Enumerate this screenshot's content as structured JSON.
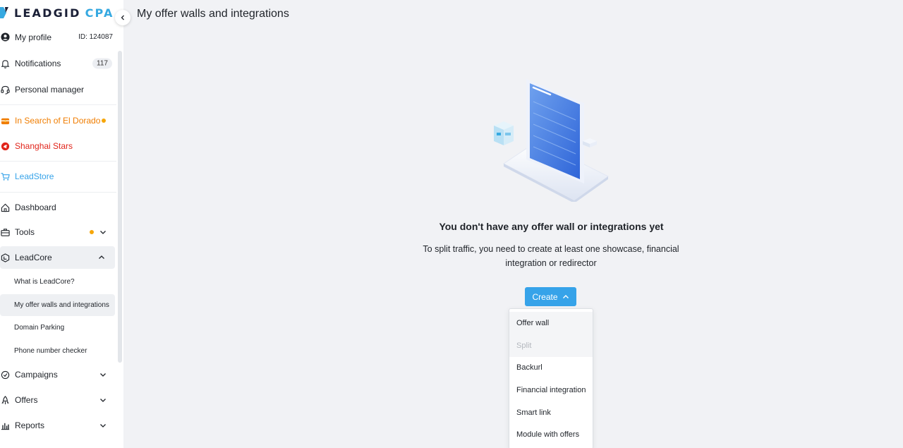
{
  "logo": {
    "brand": "LEADGID",
    "suffix": "CPA"
  },
  "profile": {
    "label": "My profile",
    "id": "ID: 124087"
  },
  "notifications": {
    "label": "Notifications",
    "count": "117"
  },
  "personal_manager": {
    "label": "Personal manager"
  },
  "promos": [
    {
      "label": "In Search of El Dorado",
      "color": "#f07d00"
    },
    {
      "label": "Shanghai Stars",
      "color": "#e1251b"
    }
  ],
  "leadstore": {
    "label": "LeadStore",
    "color": "#36a3e9"
  },
  "nav": {
    "dashboard": "Dashboard",
    "tools": "Tools",
    "leadcore": "LeadCore",
    "leadcore_items": [
      "What is LeadCore?",
      "My offer walls and integrations",
      "Domain Parking",
      "Phone number checker"
    ],
    "campaigns": "Campaigns",
    "offers": "Offers",
    "reports": "Reports"
  },
  "page_title": "My offer walls and integrations",
  "empty_state": {
    "title": "You don't have any offer wall or integrations yet",
    "desc_line1": "To split traffic, you need to create at least one showcase, financial",
    "desc_line2": "integration or redirector"
  },
  "create_button": "Create",
  "create_menu": [
    {
      "label": "Offer wall",
      "state": "hover"
    },
    {
      "label": "Split",
      "state": "disabled"
    },
    {
      "label": "Backurl",
      "state": "normal"
    },
    {
      "label": "Financial integration",
      "state": "normal"
    },
    {
      "label": "Smart link",
      "state": "normal"
    },
    {
      "label": "Module with offers",
      "state": "normal"
    }
  ],
  "colors": {
    "accent": "#36a3e9",
    "badge_dot": "#f6a609",
    "background": "#f1f2f5"
  }
}
